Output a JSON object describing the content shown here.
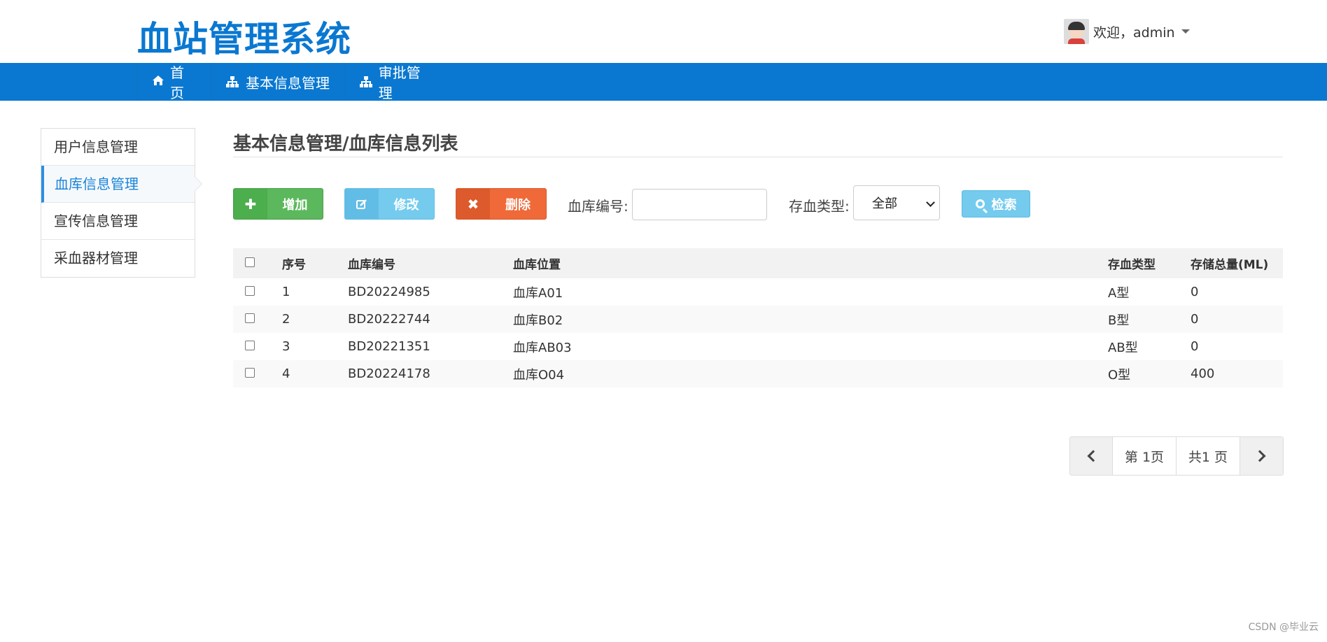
{
  "header": {
    "app_title": "血站管理系统",
    "welcome_text": "欢迎，admin"
  },
  "nav": {
    "items": [
      {
        "label": "首页",
        "icon": "home-icon"
      },
      {
        "label": "基本信息管理",
        "icon": "sitemap-icon"
      },
      {
        "label": "审批管理",
        "icon": "sitemap-icon"
      }
    ]
  },
  "sidebar": {
    "items": [
      {
        "label": "用户信息管理"
      },
      {
        "label": "血库信息管理",
        "active": true
      },
      {
        "label": "宣传信息管理"
      },
      {
        "label": "采血器材管理"
      }
    ]
  },
  "main": {
    "title": "基本信息管理/血库信息列表",
    "toolbar": {
      "add_label": "增加",
      "edit_label": "修改",
      "delete_label": "删除",
      "code_label": "血库编号:",
      "code_value": "",
      "type_label": "存血类型:",
      "type_selected": "全部",
      "search_label": "检索"
    },
    "table": {
      "columns": [
        "序号",
        "血库编号",
        "血库位置",
        "存血类型",
        "存储总量(ML)"
      ],
      "rows": [
        [
          "1",
          "BD20224985",
          "血库A01",
          "A型",
          "0"
        ],
        [
          "2",
          "BD20222744",
          "血库B02",
          "B型",
          "0"
        ],
        [
          "3",
          "BD20221351",
          "血库AB03",
          "AB型",
          "0"
        ],
        [
          "4",
          "BD20224178",
          "血库O04",
          "O型",
          "400"
        ]
      ]
    },
    "pagination": {
      "current": "第 1页",
      "total": "共1 页"
    }
  },
  "watermark": "CSDN @毕业云",
  "colors": {
    "brand": "#0a78d1",
    "add": "#5cb85c",
    "edit": "#74cbee",
    "delete": "#ef6a38"
  }
}
